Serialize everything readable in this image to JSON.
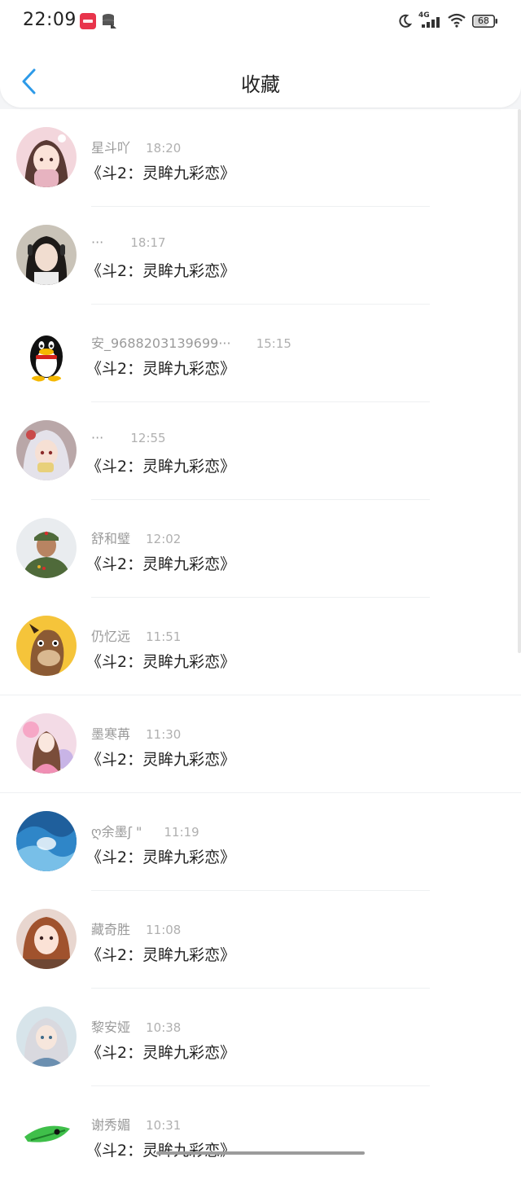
{
  "status_bar": {
    "time": "22:09",
    "network": "4G",
    "battery": "68"
  },
  "nav": {
    "title": "收藏"
  },
  "colors": {
    "accent": "#2d9ae8",
    "name_text": "#9a9a9a",
    "time_text": "#b0b0b0",
    "message_text": "#222222"
  },
  "items": [
    {
      "name": "星斗吖",
      "time": "18:20",
      "message": "《斗2：灵眸九彩恋》"
    },
    {
      "name": "···",
      "time": "18:17",
      "message": "《斗2：灵眸九彩恋》"
    },
    {
      "name": "安_9688203139699···",
      "time": "15:15",
      "message": "《斗2：灵眸九彩恋》"
    },
    {
      "name": "···",
      "time": "12:55",
      "message": "《斗2：灵眸九彩恋》"
    },
    {
      "name": "舒和璧",
      "time": "12:02",
      "message": "《斗2：灵眸九彩恋》"
    },
    {
      "name": "仍忆远",
      "time": "11:51",
      "message": "《斗2：灵眸九彩恋》"
    },
    {
      "name": "墨寒苒",
      "time": "11:30",
      "message": "《斗2：灵眸九彩恋》"
    },
    {
      "name": "ღ余墨ʃ \"",
      "time": "11:19",
      "message": "《斗2：灵眸九彩恋》"
    },
    {
      "name": "藏奇胜",
      "time": "11:08",
      "message": "《斗2：灵眸九彩恋》"
    },
    {
      "name": "黎安娅",
      "time": "10:38",
      "message": "《斗2：灵眸九彩恋》"
    },
    {
      "name": "谢秀媚",
      "time": "10:31",
      "message": "《斗2：灵眸九彩恋》"
    }
  ]
}
